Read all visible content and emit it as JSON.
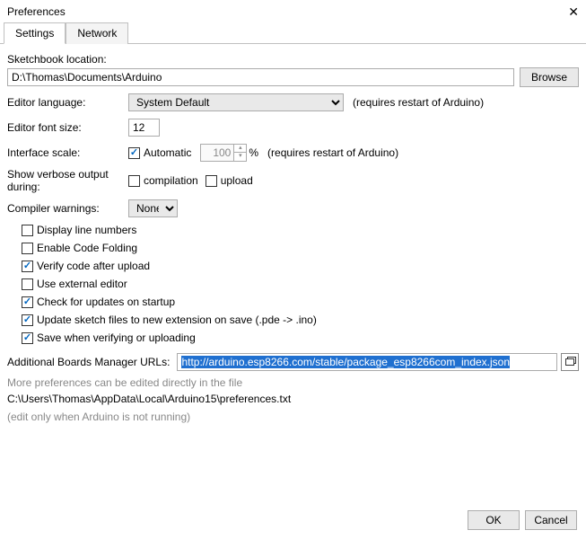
{
  "window": {
    "title": "Preferences"
  },
  "tabs": {
    "settings": "Settings",
    "network": "Network"
  },
  "labels": {
    "sketchbook_location": "Sketchbook location:",
    "browse": "Browse",
    "editor_language": "Editor language:",
    "requires_restart": "(requires restart of Arduino)",
    "editor_font_size": "Editor font size:",
    "interface_scale": "Interface scale:",
    "automatic": "Automatic",
    "percent": "%",
    "verbose_output": "Show verbose output during:",
    "compilation": "compilation",
    "upload": "upload",
    "compiler_warnings": "Compiler warnings:",
    "additional_urls": "Additional Boards Manager URLs:",
    "more_prefs_note": "More preferences can be edited directly in the file",
    "edit_only_note": "(edit only when Arduino is not running)",
    "ok": "OK",
    "cancel": "Cancel"
  },
  "values": {
    "sketchbook_path": "D:\\Thomas\\Documents\\Arduino",
    "language": "System Default",
    "font_size": "12",
    "scale": "100",
    "warnings": "None",
    "additional_url": "http://arduino.esp8266.com/stable/package_esp8266com_index.json",
    "prefs_path": "C:\\Users\\Thomas\\AppData\\Local\\Arduino15\\preferences.txt"
  },
  "checkboxes": {
    "automatic": true,
    "compilation": false,
    "upload": false,
    "display_line_numbers": {
      "label": "Display line numbers",
      "checked": false
    },
    "enable_code_folding": {
      "label": "Enable Code Folding",
      "checked": false
    },
    "verify_after_upload": {
      "label": "Verify code after upload",
      "checked": true
    },
    "use_external_editor": {
      "label": "Use external editor",
      "checked": false
    },
    "check_updates": {
      "label": "Check for updates on startup",
      "checked": true
    },
    "update_sketch_ext": {
      "label": "Update sketch files to new extension on save (.pde -> .ino)",
      "checked": true
    },
    "save_when_verify": {
      "label": "Save when verifying or uploading",
      "checked": true
    }
  }
}
